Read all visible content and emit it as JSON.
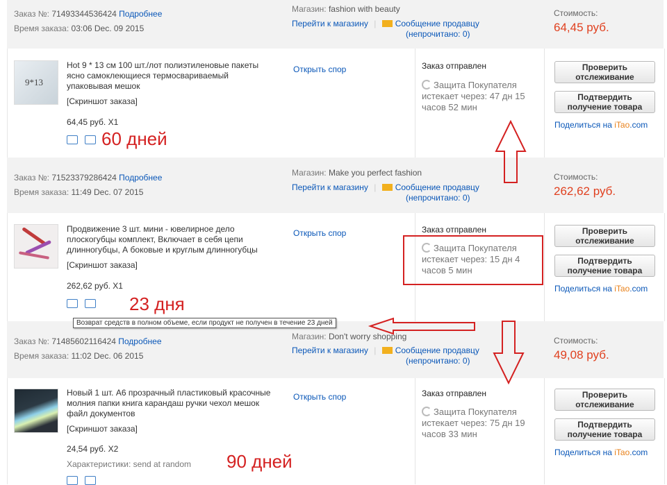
{
  "orders": [
    {
      "order_label": "Заказ №:",
      "order_number": "71493344536424",
      "details_link": "Подробнее",
      "time_label": "Время заказа:",
      "time": "03:06 Dec. 09 2015",
      "store_label": "Магазин:",
      "store_name": "fashion with beauty",
      "go_to_store": "Перейти к магазину",
      "message_seller": "Сообщение продавцу",
      "unread": "(непрочитано: 0)",
      "cost_label": "Стоимость:",
      "cost": "64,45 руб.",
      "product_title": "Hot 9 * 13 см 100 шт./лот полиэтиленовые пакеты ясно самоклеющиеся термосвариваемый упаковывая мешок",
      "snapshot": "[Скриншот заказа]",
      "price_qty": "64,45 руб. X1",
      "open_dispute": "Открыть спор",
      "status": "Заказ отправлен",
      "protection": "Защита Покупателя",
      "expires": "истекает через: 47 дн 15 часов 52 мин",
      "btn_track": "Проверить отслеживание",
      "btn_confirm": "Подтвердить получение товара",
      "share_prefix": "Поделиться на ",
      "share_site": "iTao",
      "share_suffix": ".com"
    },
    {
      "order_label": "Заказ №:",
      "order_number": "71523379286424",
      "details_link": "Подробнее",
      "time_label": "Время заказа:",
      "time": "11:49 Dec. 07 2015",
      "store_label": "Магазин:",
      "store_name": "Make you perfect fashion",
      "go_to_store": "Перейти к магазину",
      "message_seller": "Сообщение продавцу",
      "unread": "(непрочитано: 0)",
      "cost_label": "Стоимость:",
      "cost": "262,62 руб.",
      "product_title": "Продвижение 3 шт. мини - ювелирное дело плоскогубцы комплект, Включает в себя цепи длинногубцы, А боковые и круглым длинногубцы",
      "snapshot": "[Скриншот заказа]",
      "price_qty": "262,62 руб. X1",
      "open_dispute": "Открыть спор",
      "status": "Заказ отправлен",
      "protection": "Защита Покупателя",
      "expires": "истекает через: 15 дн 4 часов 5 мин",
      "btn_track": "Проверить отслеживание",
      "btn_confirm": "Подтвердить получение товара",
      "share_prefix": "Поделиться на ",
      "share_site": "iTao",
      "share_suffix": ".com"
    },
    {
      "order_label": "Заказ №:",
      "order_number": "71485602116424",
      "details_link": "Подробнее",
      "time_label": "Время заказа:",
      "time": "11:02 Dec. 06 2015",
      "store_label": "Магазин:",
      "store_name": "Don't worry shopping",
      "go_to_store": "Перейти к магазину",
      "message_seller": "Сообщение продавцу",
      "unread": "(непрочитано: 0)",
      "cost_label": "Стоимость:",
      "cost": "49,08 руб.",
      "product_title": "Новый 1 шт. А6 прозрачный пластиковый красочные молния папки книга карандаш ручки чехол мешок файл документов",
      "snapshot": "[Скриншот заказа]",
      "price_qty": "24,54 руб. X2",
      "characteristics": "Характеристики: send at random",
      "open_dispute": "Открыть спор",
      "status": "Заказ отправлен",
      "protection": "Защита Покупателя",
      "expires": "истекает через: 75 дн 19 часов 33 мин",
      "btn_track": "Проверить отслеживание",
      "btn_confirm": "Подтвердить получение товара",
      "share_prefix": "Поделиться на ",
      "share_site": "iTao",
      "share_suffix": ".com"
    }
  ],
  "annotations": {
    "days_60": "60 дней",
    "days_23": "23 дня",
    "days_90": "90 дней",
    "tooltip": "Возврат средств в полном объеме, если продукт не получен в течение 23 дней"
  },
  "colors": {
    "link": "#0a57b8",
    "price": "#e0401f",
    "annotation": "#d42121",
    "header_bg": "#f2f2f2"
  }
}
